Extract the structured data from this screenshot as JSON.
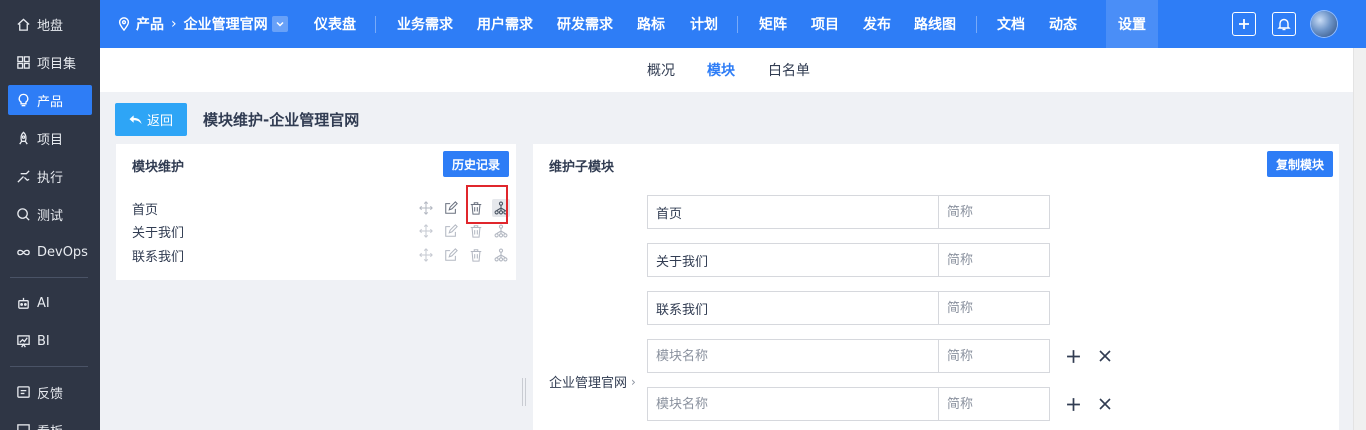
{
  "sidebar": {
    "items": [
      {
        "label": "地盘",
        "icon": "home-icon"
      },
      {
        "label": "项目集",
        "icon": "grid-icon"
      },
      {
        "label": "产品",
        "icon": "bulb-icon",
        "active": true
      },
      {
        "label": "项目",
        "icon": "rocket-icon"
      },
      {
        "label": "执行",
        "icon": "run-icon"
      },
      {
        "label": "测试",
        "icon": "search-bug-icon"
      },
      {
        "label": "DevOps",
        "icon": "infinity-icon"
      },
      {
        "label": "AI",
        "icon": "robot-icon"
      },
      {
        "label": "BI",
        "icon": "chart-board-icon"
      },
      {
        "label": "反馈",
        "icon": "feedback-icon"
      },
      {
        "label": "看板",
        "icon": "board-icon"
      }
    ]
  },
  "topbar": {
    "crumb_root": "产品",
    "crumb_product": "企业管理官网",
    "nav": [
      "仪表盘",
      "业务需求",
      "用户需求",
      "研发需求",
      "路标",
      "计划",
      "矩阵",
      "项目",
      "发布",
      "路线图",
      "文档",
      "动态"
    ],
    "settings": "设置"
  },
  "subnav": {
    "tabs": [
      "概况",
      "模块",
      "白名单"
    ],
    "active_tab": "模块"
  },
  "header": {
    "back_label": "返回",
    "title": "模块维护-企业管理官网"
  },
  "left_panel": {
    "title": "模块维护",
    "history_button": "历史记录",
    "modules": [
      "首页",
      "关于我们",
      "联系我们"
    ]
  },
  "right_panel": {
    "title": "维护子模块",
    "copy_button": "复制模块",
    "parent": "企业管理官网",
    "rows": [
      {
        "name": "首页",
        "name_placeholder": "模块名称",
        "short": "",
        "short_placeholder": "简称"
      },
      {
        "name": "关于我们",
        "name_placeholder": "模块名称",
        "short": "",
        "short_placeholder": "简称"
      },
      {
        "name": "联系我们",
        "name_placeholder": "模块名称",
        "short": "",
        "short_placeholder": "简称"
      },
      {
        "name": "",
        "name_placeholder": "模块名称",
        "short": "",
        "short_placeholder": "简称"
      },
      {
        "name": "",
        "name_placeholder": "模块名称",
        "short": "",
        "short_placeholder": "简称"
      }
    ]
  },
  "colors": {
    "primary": "#2e7df6",
    "sidebar_bg": "#2f3645",
    "back_button": "#2ea5f6",
    "highlight": "#e0262c"
  }
}
